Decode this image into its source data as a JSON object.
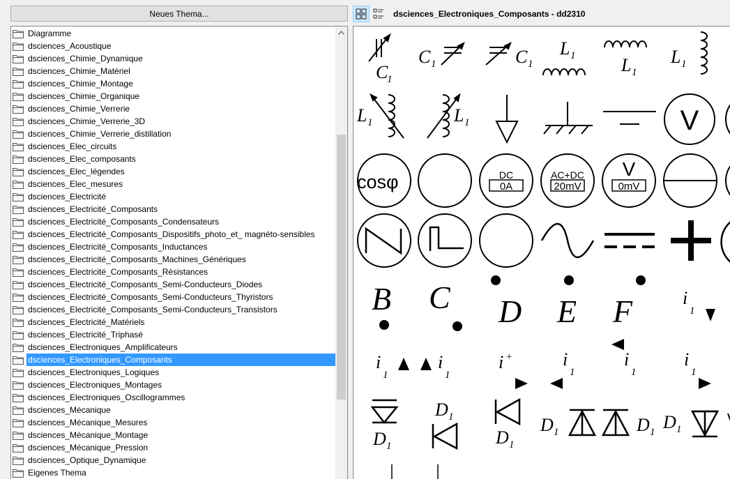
{
  "toolbar": {
    "new_theme_label": "Neues Thema...",
    "title": "dsciences_Electroniques_Composants - dd2310"
  },
  "themes": [
    "Diagramme",
    "dsciences_Acoustique",
    "dsciences_Chimie_Dynamique",
    "dsciences_Chimie_Matériel",
    "dsciences_Chimie_Montage",
    "dsciences_Chimie_Organique",
    "dsciences_Chimie_Verrerie",
    "dsciences_Chimie_Verrerie_3D",
    "dsciences_Chimie_Verrerie_distillation",
    "dsciences_Elec_circuits",
    "dsciences_Elec_composants",
    "dsciences_Elec_légendes",
    "dsciences_Elec_mesures",
    "dsciences_Electricité",
    "dsciences_Electricité_Composants",
    "dsciences_Electricité_Composants_Condensateurs",
    "dsciences_Electricité_Composants_Dispositifs_photo_et_ magnéto-sensibles",
    "dsciences_Electricité_Composants_Inductances",
    "dsciences_Electricité_Composants_Machines_Génériques",
    "dsciences_Electricité_Composants_Résistances",
    "dsciences_Electricité_Composants_Semi-Conducteurs_Diodes",
    "dsciences_Electricité_Composants_Semi-Conducteurs_Thyristors",
    "dsciences_Electricité_Composants_Semi-Conducteurs_Transistors",
    "dsciences_Electricité_Matériels",
    "dsciences_Electricité_Triphasé",
    "dsciences_Electroniques_Amplificateurs",
    "dsciences_Electroniques_Composants",
    "dsciences_Electroniques_Logiques",
    "dsciences_Electroniques_Montages",
    "dsciences_Electroniques_Oscillogrammes",
    "dsciences_Mécanique",
    "dsciences_Mécanique_Mesures",
    "dsciences_Mécanique_Montage",
    "dsciences_Mécanique_Pression",
    "dsciences_Optique_Dynamique",
    "Eigenes Thema"
  ],
  "selected_theme": "dsciences_Electroniques_Composants",
  "symbols": {
    "c": "C",
    "sub1": "1",
    "l": "L",
    "v": "V",
    "cosphi": "cosφ",
    "dc": "DC",
    "zero_a": "0A",
    "acdc": "AC+DC",
    "twenty_mv": "20mV",
    "zero_mv": "0mV",
    "b": "B",
    "c_letter": "C",
    "d": "D",
    "e": "E",
    "f": "F",
    "i": "i",
    "plus": "+"
  },
  "colors": {
    "selection": "#3399ff",
    "view_active": "#cce8ff"
  }
}
